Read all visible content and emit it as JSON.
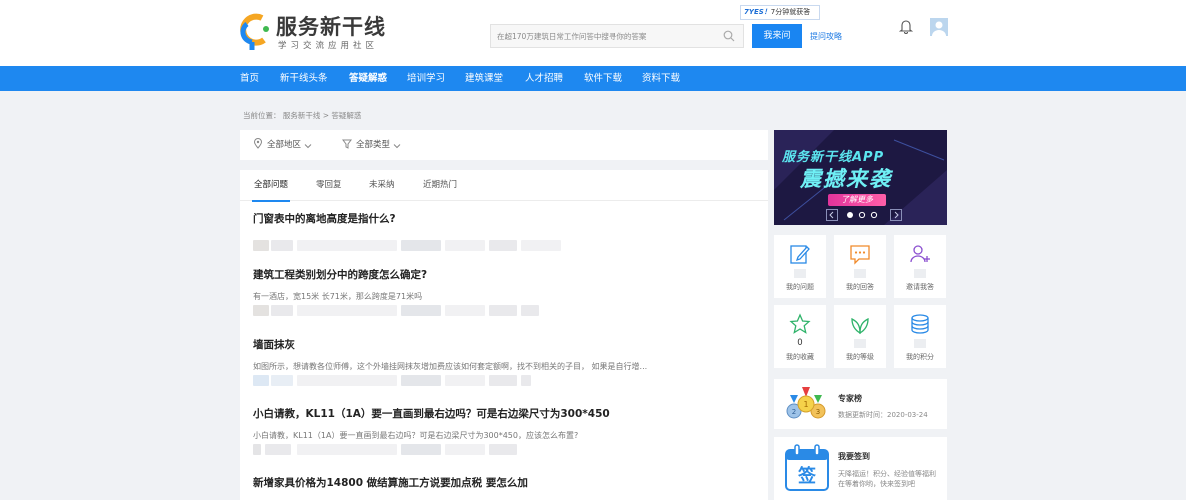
{
  "header": {
    "logo_title": "服务新干线",
    "logo_subtitle": "学习交流应用社区",
    "search_placeholder": "在超170万建筑日常工作问答中搜寻你的答案",
    "ask_button": "我来问",
    "ask_guide": "提问攻略",
    "promo_badge_a": "7YES！",
    "promo_badge_b": "7分钟就获答",
    "icons": [
      "logo-icon",
      "search-icon",
      "bell-icon",
      "avatar-icon"
    ]
  },
  "nav": {
    "items": [
      "首页",
      "新干线头条",
      "答疑解惑",
      "培训学习",
      "建筑课堂",
      "人才招聘",
      "软件下载",
      "资料下载"
    ],
    "active": "答疑解惑"
  },
  "breadcrumb": "当前位置： 服务新干线 > 答疑解惑",
  "filters": {
    "region": "全部地区",
    "type": "全部类型"
  },
  "tabs": [
    "全部问题",
    "零回复",
    "未采纳",
    "近期热门"
  ],
  "active_tab": "全部问题",
  "questions": [
    {
      "title": "门窗表中的离地高度是指什么?",
      "desc": ""
    },
    {
      "title": "建筑工程类别划分中的跨度怎么确定?",
      "desc": "有一酒店，宽15米 长71米，那么跨度是71米吗"
    },
    {
      "title": "墙面抹灰",
      "desc": "如图所示，想请教各位师傅，这个外墙挂网抹灰增加费应该如何套定额啊，找不到相关的子目， 如果是自行增..."
    },
    {
      "title": "小白请教，KL11（1A）要一直画到最右边吗？可是右边梁尺寸为300*450",
      "desc": "小白请教，KL11（1A）要一直画到最右边吗？可是右边梁尺寸为300*450，应该怎么布置?"
    },
    {
      "title": "新增家具价格为14800 做结算施工方说要加点税 要怎么加",
      "desc": ""
    }
  ],
  "sidebar": {
    "banner": {
      "title": "服务新干线APP",
      "headline": "震撼来袭",
      "button": "了解更多"
    },
    "grid": [
      {
        "label": "我的问题",
        "value": "",
        "icon": "edit-icon",
        "color": "#2a8ae6"
      },
      {
        "label": "我的回答",
        "value": "",
        "icon": "chat-icon",
        "color": "#f08a2b"
      },
      {
        "label": "邀请我答",
        "value": "",
        "icon": "add-user-icon",
        "color": "#8b4fd0"
      },
      {
        "label": "我的收藏",
        "value": "0",
        "icon": "star-icon",
        "color": "#2fb36a"
      },
      {
        "label": "我的等级",
        "value": "",
        "icon": "leaf-icon",
        "color": "#2fb36a"
      },
      {
        "label": "我的积分",
        "value": "",
        "icon": "coins-icon",
        "color": "#2a8ae6"
      }
    ],
    "expert": {
      "title": "专家榜",
      "updated": "数据更新时间：2020-03-24"
    },
    "signin": {
      "title": "我要签到",
      "desc": "天降福运！积分、经验值等福利在等着你哟，快来签到吧",
      "icon_text": "签"
    }
  }
}
